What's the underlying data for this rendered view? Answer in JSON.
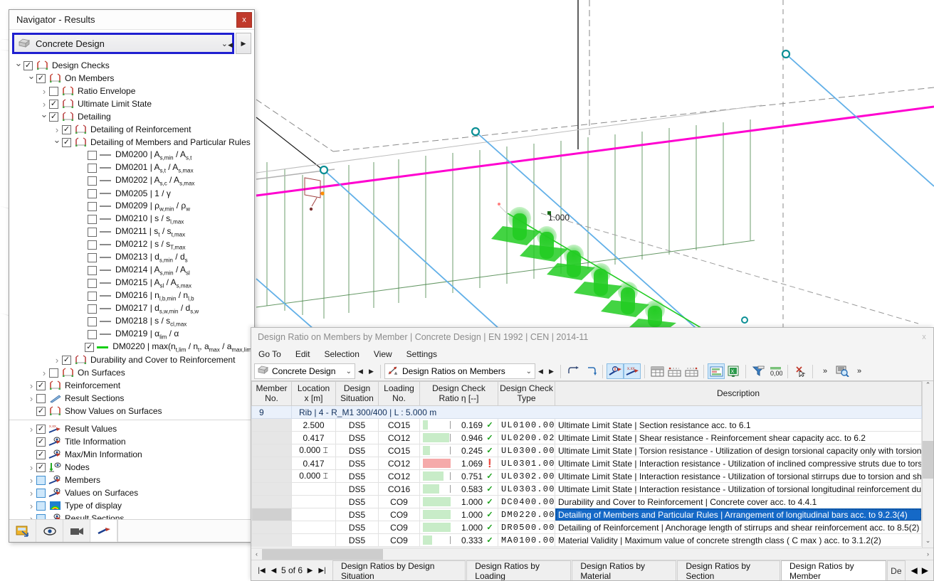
{
  "navigator": {
    "title": "Navigator - Results",
    "close_label": "x",
    "combo_value": "Concrete Design",
    "combo_chevron": "⌄",
    "side_button": "▶",
    "tree": [
      {
        "depth": 0,
        "twisty": "open",
        "check": "checked",
        "icon": "design-checks-icon",
        "label": "Design Checks"
      },
      {
        "depth": 1,
        "twisty": "open",
        "check": "checked",
        "icon": "members-icon",
        "label": "On Members"
      },
      {
        "depth": 2,
        "twisty": "closed",
        "check": "unchecked",
        "icon": "ratio-envelope-icon",
        "label": "Ratio Envelope"
      },
      {
        "depth": 2,
        "twisty": "closed",
        "check": "checked",
        "icon": "uls-icon",
        "label": "Ultimate Limit State"
      },
      {
        "depth": 2,
        "twisty": "open",
        "check": "checked",
        "icon": "detailing-icon",
        "label": "Detailing"
      },
      {
        "depth": 3,
        "twisty": "closed",
        "check": "checked",
        "icon": "detailing-reinf-icon",
        "label": "Detailing of Reinforcement"
      },
      {
        "depth": 3,
        "twisty": "open",
        "check": "checked",
        "icon": "detailing-members-icon",
        "label": "Detailing of Members and Particular Rules"
      },
      {
        "depth": 5,
        "twisty": "none",
        "check": "unchecked",
        "icon": "line-style-icon",
        "label": "DM0200 | A<sub>s,min</sub> / A<sub>s,t</sub>"
      },
      {
        "depth": 5,
        "twisty": "none",
        "check": "unchecked",
        "icon": "line-style-icon",
        "label": "DM0201 | A<sub>s,t</sub> / A<sub>s,max</sub>"
      },
      {
        "depth": 5,
        "twisty": "none",
        "check": "unchecked",
        "icon": "line-style-icon",
        "label": "DM0202 | A<sub>s,c</sub> / A<sub>s,max</sub>"
      },
      {
        "depth": 5,
        "twisty": "none",
        "check": "unchecked",
        "icon": "line-style-icon",
        "label": "DM0205 | 1 / γ"
      },
      {
        "depth": 5,
        "twisty": "none",
        "check": "unchecked",
        "icon": "line-style-icon",
        "label": "DM0209 | ρ<sub>w,min</sub> / ρ<sub>w</sub>"
      },
      {
        "depth": 5,
        "twisty": "none",
        "check": "unchecked",
        "icon": "line-style-icon",
        "label": "DM0210 | s / s<sub>l,max</sub>"
      },
      {
        "depth": 5,
        "twisty": "none",
        "check": "unchecked",
        "icon": "line-style-icon",
        "label": "DM0211 | s<sub>t</sub> / s<sub>t,max</sub>"
      },
      {
        "depth": 5,
        "twisty": "none",
        "check": "unchecked",
        "icon": "line-style-icon",
        "label": "DM0212 | s / s<sub>T,max</sub>"
      },
      {
        "depth": 5,
        "twisty": "none",
        "check": "unchecked",
        "icon": "line-style-icon",
        "label": "DM0213 | d<sub>s,min</sub> / d<sub>s</sub>"
      },
      {
        "depth": 5,
        "twisty": "none",
        "check": "unchecked",
        "icon": "line-style-icon",
        "label": "DM0214 | A<sub>s,min</sub> / A<sub>sl</sub>"
      },
      {
        "depth": 5,
        "twisty": "none",
        "check": "unchecked",
        "icon": "line-style-icon",
        "label": "DM0215 | A<sub>sl</sub> / A<sub>s,max</sub>"
      },
      {
        "depth": 5,
        "twisty": "none",
        "check": "unchecked",
        "icon": "line-style-icon",
        "label": "DM0216 | n<sub>l,b,min</sub> / n<sub>l,b</sub>"
      },
      {
        "depth": 5,
        "twisty": "none",
        "check": "unchecked",
        "icon": "line-style-icon",
        "label": "DM0217 | d<sub>s,w,min</sub> / d<sub>s,w</sub>"
      },
      {
        "depth": 5,
        "twisty": "none",
        "check": "unchecked",
        "icon": "line-style-icon",
        "label": "DM0218 | s / s<sub>cl,max</sub>"
      },
      {
        "depth": 5,
        "twisty": "none",
        "check": "unchecked",
        "icon": "line-style-icon",
        "label": "DM0219 | α<sub>lim</sub> / α"
      },
      {
        "depth": 5,
        "twisty": "none",
        "check": "checked",
        "icon": "line-style-green-icon",
        "label": "DM0220 | max(n<sub>t,lim</sub> / n<sub>t</sub>, a<sub>max</sub> / a<sub>max,lim</sub>)"
      },
      {
        "depth": 3,
        "twisty": "closed",
        "check": "checked",
        "icon": "durability-icon",
        "label": "Durability and Cover to Reinforcement"
      },
      {
        "depth": 2,
        "twisty": "closed",
        "check": "unchecked",
        "icon": "surfaces-icon",
        "label": "On Surfaces"
      },
      {
        "depth": 1,
        "twisty": "closed",
        "check": "checked",
        "icon": "reinforcement-icon",
        "label": "Reinforcement"
      },
      {
        "depth": 1,
        "twisty": "closed",
        "check": "unchecked",
        "icon": "result-sections-icon",
        "label": "Result Sections"
      },
      {
        "depth": 1,
        "twisty": "none",
        "check": "checked",
        "icon": "show-values-icon",
        "label": "Show Values on Surfaces"
      },
      {
        "separator": true
      },
      {
        "depth": 1,
        "twisty": "closed",
        "check": "checked",
        "icon": "result-values-icon",
        "label": "Result Values"
      },
      {
        "depth": 1,
        "twisty": "none",
        "check": "checked",
        "icon": "title-info-icon",
        "label": "Title Information"
      },
      {
        "depth": 1,
        "twisty": "none",
        "check": "checked",
        "icon": "maxmin-info-icon",
        "label": "Max/Min Information"
      },
      {
        "depth": 1,
        "twisty": "closed",
        "check": "checked",
        "icon": "nodes-icon",
        "label": "Nodes"
      },
      {
        "depth": 1,
        "twisty": "closed",
        "check": "blue",
        "icon": "members-display-icon",
        "label": "Members"
      },
      {
        "depth": 1,
        "twisty": "closed",
        "check": "blue",
        "icon": "values-surfaces-icon",
        "label": "Values on Surfaces"
      },
      {
        "depth": 1,
        "twisty": "closed",
        "check": "blue",
        "icon": "type-of-display-icon",
        "label": "Type of display"
      },
      {
        "depth": 1,
        "twisty": "closed",
        "check": "blue",
        "icon": "result-sections-display-icon",
        "label": "Result Sections"
      }
    ],
    "bottom_tabs": [
      "project-navigator-icon",
      "visibility-icon",
      "camera-icon",
      "results-icon"
    ]
  },
  "viewport": {
    "dimension_label": "1.000"
  },
  "table_window": {
    "title": "Design Ratio on Members by Member | Concrete Design | EN 1992 | CEN | 2014-11",
    "close_label": "x",
    "menu": [
      "Go To",
      "Edit",
      "Selection",
      "View",
      "Settings"
    ],
    "combo1_value": "Concrete Design",
    "combo2_value": "Design Ratios on Members",
    "chevron": "⌄",
    "nav_prev": "◀",
    "nav_next": "▶",
    "toolbar_icons": [
      "undo-arrow-icon",
      "redo-arrow-icon",
      "show-result-diagram-icon",
      "show-values-icon",
      "table-grid-icon",
      "table-row-icon",
      "table-column-icon",
      "result-bars-icon",
      "export-excel-icon",
      "filter-icon",
      "decimal-places-icon",
      "clear-selection-icon",
      "overflow-icon",
      "find-in-table-icon",
      "overflow2-icon"
    ],
    "columns": [
      {
        "label": "Member\nNo.",
        "key": "member_no"
      },
      {
        "label": "Location\nx [m]",
        "key": "location"
      },
      {
        "label": "Design\nSituation",
        "key": "design_situation"
      },
      {
        "label": "Loading\nNo.",
        "key": "loading_no"
      },
      {
        "label": "Design Check\nRatio η [--]",
        "key": "ratio"
      },
      {
        "label": "Design Check\nType",
        "key": "check_type"
      },
      {
        "label": "Description",
        "key": "description"
      }
    ],
    "group_row": {
      "member_no": "9",
      "text": "Rib | 4 - R_M1 300/400 | L : 5.000 m"
    },
    "rows": [
      {
        "member_no": "",
        "location": "2.500",
        "loc_icon": "",
        "design_situation": "DS5",
        "loading_no": "CO15",
        "ratio": "0.169",
        "ratio_pct": 16.9,
        "status": "ok",
        "check_type": "UL0100.00",
        "description": "Ultimate Limit State | Section resistance acc. to 6.1",
        "selected": false
      },
      {
        "member_no": "",
        "location": "0.417",
        "loc_icon": "",
        "design_situation": "DS5",
        "loading_no": "CO12",
        "ratio": "0.946",
        "ratio_pct": 94.6,
        "status": "ok",
        "check_type": "UL0200.02",
        "description": "Ultimate Limit State | Shear resistance - Reinforcement shear capacity acc. to 6.2",
        "selected": false
      },
      {
        "member_no": "",
        "location": "0.000",
        "loc_icon": "⌶",
        "design_situation": "DS5",
        "loading_no": "CO15",
        "ratio": "0.245",
        "ratio_pct": 24.5,
        "status": "ok",
        "check_type": "UL0300.00",
        "description": "Ultimate Limit State | Torsion resistance - Utilization of design torsional capacity only with torsion mom",
        "selected": false
      },
      {
        "member_no": "",
        "location": "0.417",
        "loc_icon": "",
        "design_situation": "DS5",
        "loading_no": "CO12",
        "ratio": "1.069",
        "ratio_pct": 100,
        "status": "bad",
        "check_type": "UL0301.00",
        "description": "Ultimate Limit State | Interaction resistance - Utilization of inclined compressive struts due to torsion an",
        "selected": false
      },
      {
        "member_no": "",
        "location": "0.000",
        "loc_icon": "⌶",
        "design_situation": "DS5",
        "loading_no": "CO12",
        "ratio": "0.751",
        "ratio_pct": 75.1,
        "status": "ok",
        "check_type": "UL0302.00",
        "description": "Ultimate Limit State | Interaction resistance - Utilization of torsional stirrups due to torsion and shear a",
        "selected": false
      },
      {
        "member_no": "",
        "location": "",
        "loc_icon": "",
        "design_situation": "DS5",
        "loading_no": "CO16",
        "ratio": "0.583",
        "ratio_pct": 58.3,
        "status": "ok",
        "check_type": "UL0303.00",
        "description": "Ultimate Limit State | Interaction resistance - Utilization of torsional longitudinal reinforcement due to t",
        "selected": false
      },
      {
        "member_no": "",
        "location": "",
        "loc_icon": "",
        "design_situation": "DS5",
        "loading_no": "CO9",
        "ratio": "1.000",
        "ratio_pct": 100,
        "status": "ok",
        "check_type": "DC0400.00",
        "description": "Durability and Cover to Reinforcement | Concrete cover acc. to 4.4.1",
        "selected": false
      },
      {
        "member_no": "",
        "location": "",
        "loc_icon": "",
        "design_situation": "DS5",
        "loading_no": "CO9",
        "ratio": "1.000",
        "ratio_pct": 100,
        "status": "ok",
        "check_type": "DM0220.00",
        "description": "Detailing of Members and Particular Rules | Arrangement of longitudinal bars acc. to 9.2.3(4)",
        "selected": true
      },
      {
        "member_no": "",
        "location": "",
        "loc_icon": "",
        "design_situation": "DS5",
        "loading_no": "CO9",
        "ratio": "1.000",
        "ratio_pct": 100,
        "status": "ok",
        "check_type": "DR0500.00",
        "description": "Detailing of Reinforcement | Anchorage length of stirrups and shear reinforcement acc. to 8.5(2)",
        "selected": false
      },
      {
        "member_no": "",
        "location": "",
        "loc_icon": "",
        "design_situation": "DS5",
        "loading_no": "CO9",
        "ratio": "0.333",
        "ratio_pct": 33.3,
        "status": "ok",
        "check_type": "MA0100.00",
        "description": "Material Validity | Maximum value of concrete strength class ( C max ) acc. to 3.1.2(2)",
        "selected": false
      }
    ],
    "pager": {
      "first": "|◀",
      "prev": "◀",
      "text": "5 of 6",
      "next": "▶",
      "last": "▶|"
    },
    "tabs": [
      {
        "label": "Design Ratios by Design Situation",
        "active": false
      },
      {
        "label": "Design Ratios by Loading",
        "active": false
      },
      {
        "label": "Design Ratios by Material",
        "active": false
      },
      {
        "label": "Design Ratios by Section",
        "active": false
      },
      {
        "label": "Design Ratios by Member",
        "active": true
      },
      {
        "label": "De",
        "active": false,
        "partial": true
      }
    ],
    "tab_scroll_prev": "◀",
    "tab_scroll_next": "▶"
  },
  "colors": {
    "accent_blue": "#1f1fd0",
    "selection_blue": "#1569c7",
    "ratio_green": "#c8ecc8",
    "ratio_red": "#f5aaaa",
    "magenta_member": "#ff00d0",
    "result_green": "#22cc22",
    "support_blue": "#62b0e8"
  }
}
